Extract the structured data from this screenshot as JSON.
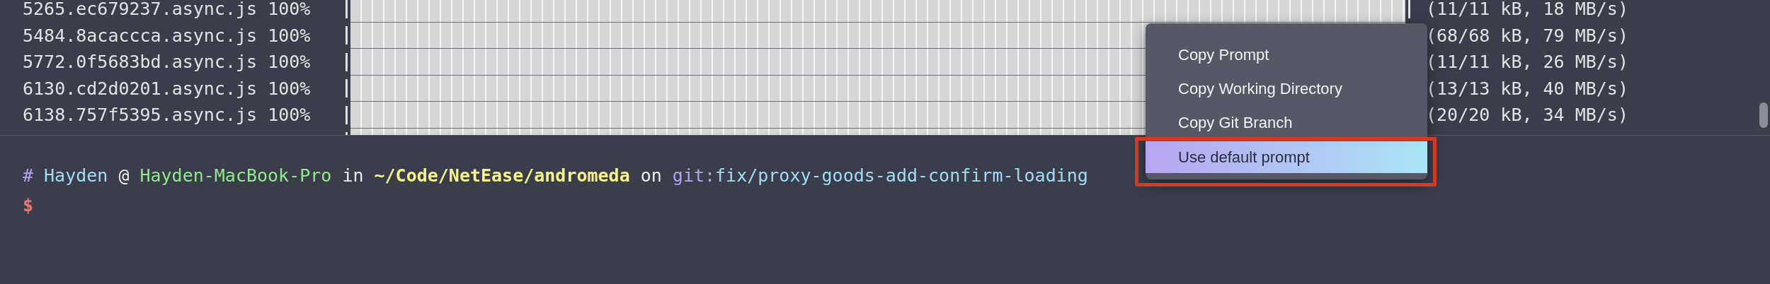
{
  "output_rows": [
    {
      "file": "5265.ec679237.async.js",
      "percent": "100%",
      "level": 1,
      "stats": "(11/11 kB, 18 MB/s)"
    },
    {
      "file": "5484.8acaccca.async.js",
      "percent": "100%",
      "level": 1,
      "stats": "(68/68 kB, 79 MB/s)"
    },
    {
      "file": "5772.0f5683bd.async.js",
      "percent": "100%",
      "level": 1,
      "stats": "(11/11 kB, 26 MB/s)"
    },
    {
      "file": "6130.cd2d0201.async.js",
      "percent": "100%",
      "level": 1,
      "stats": "(13/13 kB, 40 MB/s)"
    },
    {
      "file": "6138.757f5395.async.js",
      "percent": "100%",
      "level": 1,
      "stats": "(20/20 kB, 34 MB/s)"
    },
    {
      "level": 1
    }
  ],
  "prompt": {
    "segments": [
      {
        "kind": "symbol",
        "text": "#"
      },
      {
        "kind": "user",
        "text": "Hayden"
      },
      {
        "kind": "plain",
        "text": "@"
      },
      {
        "kind": "host",
        "text": "Hayden-MacBook-Pro"
      },
      {
        "kind": "plain",
        "text": "in"
      },
      {
        "kind": "path",
        "text": "~/Code/NetEase/andromeda"
      },
      {
        "kind": "plain",
        "text": "on"
      },
      {
        "kind": "branch",
        "label": "git:",
        "text": "fix/proxy-goods-add-confirm-loading"
      }
    ],
    "cursor": "$"
  },
  "context_menu": {
    "items": [
      {
        "label": "Copy Prompt",
        "selected": false
      },
      {
        "label": "Copy Working Directory",
        "selected": false
      },
      {
        "label": "Copy Git Branch",
        "selected": false
      },
      {
        "label": "Use default prompt",
        "selected": true
      }
    ]
  }
}
